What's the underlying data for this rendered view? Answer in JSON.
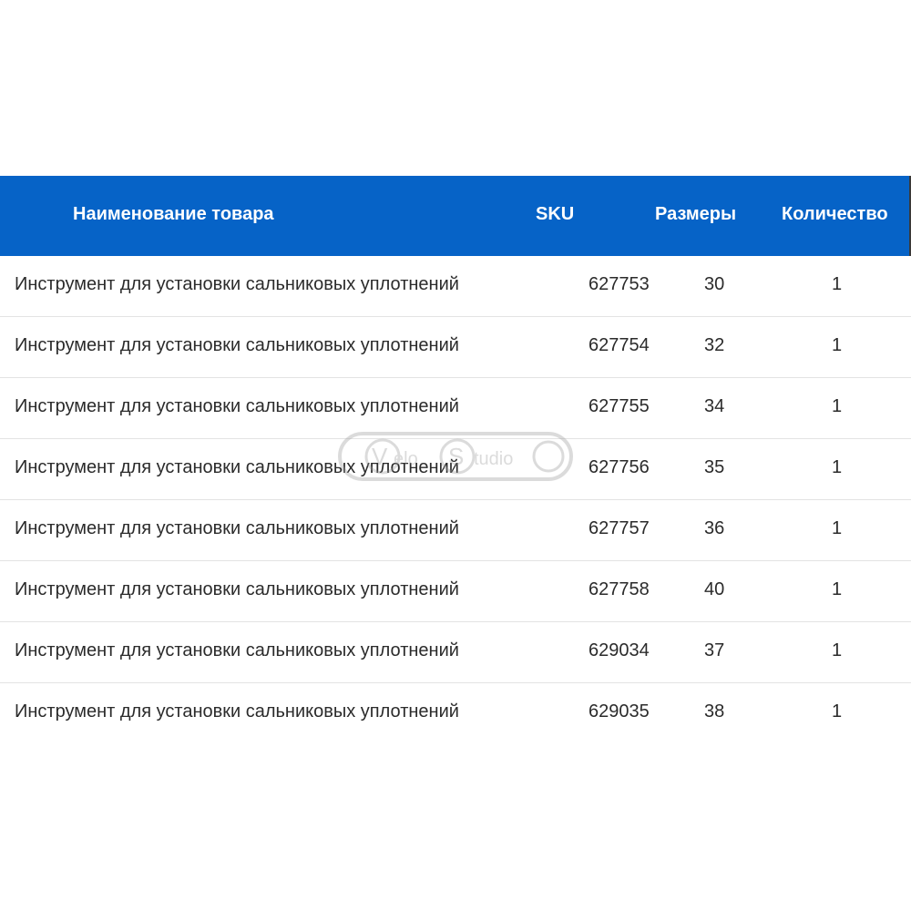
{
  "table": {
    "headers": {
      "name": "Наименование товара",
      "sku": "SKU",
      "size": "Размеры",
      "qty": "Количество"
    },
    "rows": [
      {
        "name": "Инструмент для установки сальниковых уплотнений",
        "sku": "627753",
        "size": "30",
        "qty": "1"
      },
      {
        "name": "Инструмент для установки сальниковых уплотнений",
        "sku": "627754",
        "size": "32",
        "qty": "1"
      },
      {
        "name": "Инструмент для установки сальниковых уплотнений",
        "sku": "627755",
        "size": "34",
        "qty": "1"
      },
      {
        "name": "Инструмент для установки сальниковых уплотнений",
        "sku": "627756",
        "size": "35",
        "qty": "1"
      },
      {
        "name": "Инструмент для установки сальниковых уплотнений",
        "sku": "627757",
        "size": "36",
        "qty": "1"
      },
      {
        "name": "Инструмент для установки сальниковых уплотнений",
        "sku": "627758",
        "size": "40",
        "qty": "1"
      },
      {
        "name": "Инструмент для установки сальниковых уплотнений",
        "sku": "629034",
        "size": "37",
        "qty": "1"
      },
      {
        "name": "Инструмент для установки сальниковых уплотнений",
        "sku": "629035",
        "size": "38",
        "qty": "1"
      }
    ]
  },
  "watermark": {
    "text": "VeloStudio"
  },
  "colors": {
    "header_bg": "#0663c7",
    "header_text": "#ffffff",
    "row_text": "#2b2b2b",
    "row_divider": "#e3e3e3"
  }
}
